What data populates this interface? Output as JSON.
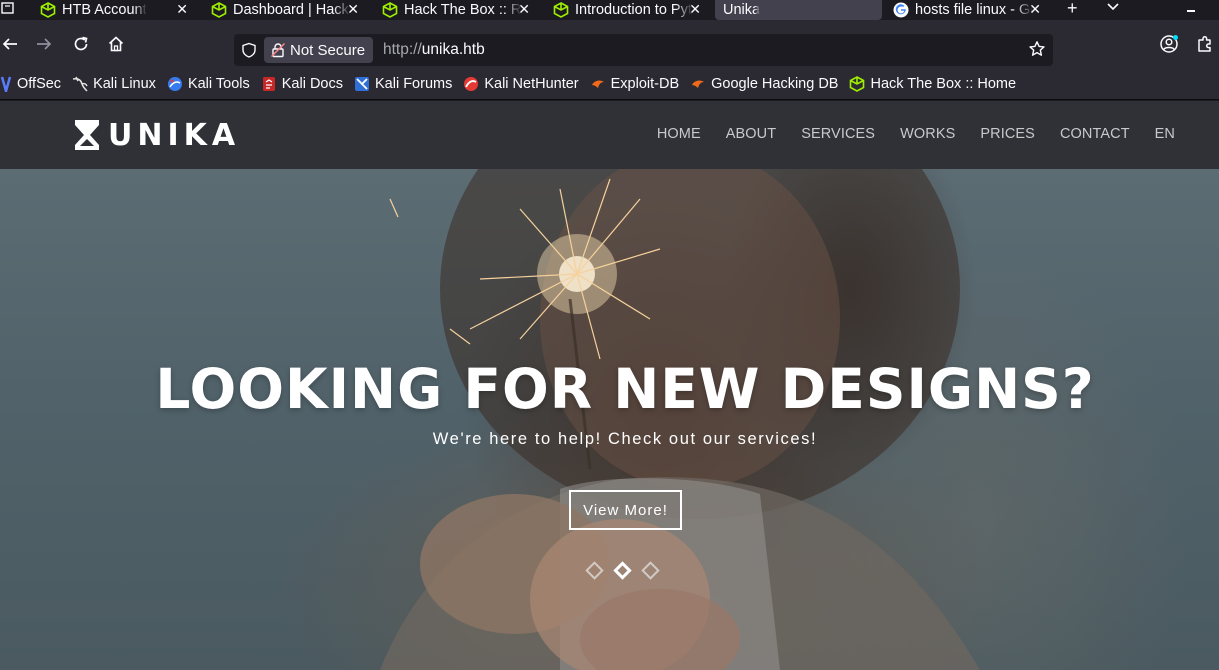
{
  "tabs": [
    {
      "title": "HTB Account",
      "icon": "htb-cube-icon",
      "active": false
    },
    {
      "title": "Dashboard | Hack The Box",
      "icon": "htb-cube-icon",
      "active": false
    },
    {
      "title": "Hack The Box :: Reset",
      "icon": "htb-cube-icon",
      "active": false
    },
    {
      "title": "Introduction to Python",
      "icon": "htb-cube-icon",
      "active": false
    },
    {
      "title": "Unika",
      "icon": "",
      "active": true
    },
    {
      "title": "hosts file linux - Google",
      "icon": "google-icon",
      "active": false
    }
  ],
  "toolbar": {
    "security_label": "Not Secure",
    "url_prefix": "http://",
    "url_host": "unika.htb"
  },
  "bookmarks": [
    {
      "label": "OffSec",
      "icon": "offsec-icon"
    },
    {
      "label": "Kali Linux",
      "icon": "kali-dragon-icon"
    },
    {
      "label": "Kali Tools",
      "icon": "kali-tools-icon"
    },
    {
      "label": "Kali Docs",
      "icon": "kali-docs-icon"
    },
    {
      "label": "Kali Forums",
      "icon": "kali-forums-icon"
    },
    {
      "label": "Kali NetHunter",
      "icon": "nethunter-icon"
    },
    {
      "label": "Exploit-DB",
      "icon": "exploitdb-icon"
    },
    {
      "label": "Google Hacking DB",
      "icon": "ghdb-icon"
    },
    {
      "label": "Hack The Box :: Home",
      "icon": "htb-cube-icon"
    }
  ],
  "site": {
    "logo_text": "UNIKA",
    "menu": [
      "HOME",
      "ABOUT",
      "SERVICES",
      "WORKS",
      "PRICES",
      "CONTACT",
      "EN"
    ],
    "hero_title": "LOOKING FOR NEW DESIGNS?",
    "hero_subtitle": "We're here to help! Check out our services!",
    "hero_button": "View More!",
    "slides_total": 3,
    "slide_active": 2
  },
  "colors": {
    "browser_bg": "#1c1b22",
    "toolbar_bg": "#2b2a33",
    "tab_active": "#42414d",
    "htb_green": "#9fef00",
    "site_header": "#2f3136"
  }
}
